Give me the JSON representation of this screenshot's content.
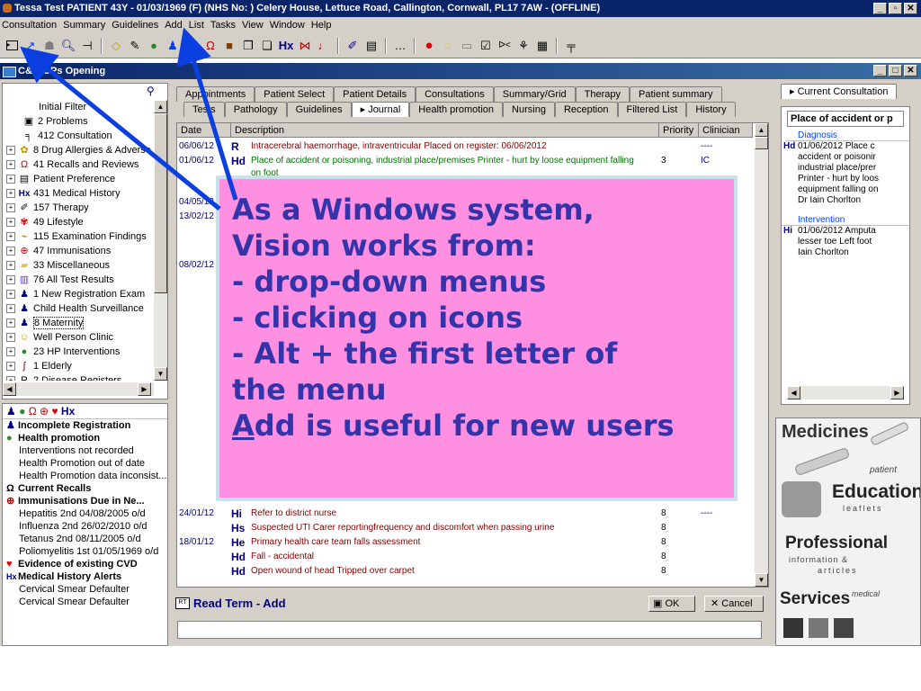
{
  "window": {
    "title": "Tessa Test PATIENT 43Y - 01/03/1969 (F) (NHS No: ) Celery House, Lettuce Road, Callington, Cornwall, PL17 7AW - (OFFLINE)",
    "child_title": "C&G GPs  Opening"
  },
  "menu": [
    "Consultation",
    "Summary",
    "Guidelines",
    "Add",
    "List",
    "Tasks",
    "View",
    "Window",
    "Help"
  ],
  "toolbar_icons": [
    "consultation-icon",
    "arrow-icon",
    "people-icon",
    "search-icon",
    "hammer-icon",
    "diamond-icon",
    "pen-icon",
    "apple-icon",
    "person-icon",
    "fork-icon",
    "recall-icon",
    "stop-icon",
    "copy-icon",
    "pages-icon",
    "rx-icon",
    "link-icon",
    "hook-icon",
    "pencil-icon",
    "note-icon",
    "ellipsis-icon",
    "red-dot-icon",
    "bubble-icon",
    "tape-icon",
    "edit-icon",
    "ab-icon",
    "pen-mark-icon",
    "calendar-icon",
    "flag-icon"
  ],
  "tree": {
    "items": [
      {
        "label": "Initial Filter",
        "icon": "",
        "exp": ""
      },
      {
        "label": "2 Problems",
        "icon": "problems-icon",
        "exp": ""
      },
      {
        "label": "412 Consultation",
        "icon": "consultation-icon",
        "exp": ""
      },
      {
        "label": "8 Drug Allergies & Adverse",
        "icon": "allergy-icon",
        "exp": "+"
      },
      {
        "label": "41 Recalls and Reviews",
        "icon": "recall-icon",
        "exp": "+"
      },
      {
        "label": "Patient Preference",
        "icon": "preference-icon",
        "exp": "+"
      },
      {
        "label": "431 Medical History",
        "icon": "rx-icon",
        "exp": "+"
      },
      {
        "label": "157 Therapy",
        "icon": "therapy-icon",
        "exp": "+"
      },
      {
        "label": "49 Lifestyle",
        "icon": "lifestyle-icon",
        "exp": "+"
      },
      {
        "label": "115 Examination Findings",
        "icon": "examination-icon",
        "exp": "+"
      },
      {
        "label": "47 Immunisations",
        "icon": "immunisation-icon",
        "exp": "+"
      },
      {
        "label": "33 Miscellaneous",
        "icon": "folder-icon",
        "exp": "+"
      },
      {
        "label": "76 All Test Results",
        "icon": "test-icon",
        "exp": "+"
      },
      {
        "label": "1 New Registration Exam",
        "icon": "person-icon",
        "exp": "+"
      },
      {
        "label": "Child Health Surveillance",
        "icon": "child-icon",
        "exp": "+"
      },
      {
        "label": "8 Maternity",
        "icon": "maternity-icon",
        "exp": "+"
      },
      {
        "label": "Well Person Clinic",
        "icon": "smiley-icon",
        "exp": "+"
      },
      {
        "label": "23 HP Interventions",
        "icon": "apple-icon",
        "exp": "+"
      },
      {
        "label": "1 Elderly",
        "icon": "elderly-icon",
        "exp": "+"
      },
      {
        "label": "2 Disease Registers",
        "icon": "register-icon",
        "exp": "+"
      }
    ]
  },
  "alerts": [
    {
      "text": "Incomplete Registration",
      "style": "b",
      "icon": "person-icon"
    },
    {
      "text": "Health promotion",
      "style": "b",
      "icon": "apple-icon"
    },
    {
      "text": "Interventions not recorded",
      "style": "ind",
      "icon": ""
    },
    {
      "text": "Health Promotion out of date",
      "style": "ind",
      "icon": ""
    },
    {
      "text": "Health Promotion data inconsist...",
      "style": "ind",
      "icon": ""
    },
    {
      "text": "Current Recalls",
      "style": "b",
      "icon": "recall-icon"
    },
    {
      "text": "Immunisations Due in Ne...",
      "style": "b",
      "icon": "immunisation-icon"
    },
    {
      "text": "Hepatitis 2nd 04/08/2005  o/d",
      "style": "ind",
      "icon": ""
    },
    {
      "text": "Influenza 2nd 26/02/2010  o/d",
      "style": "ind",
      "icon": ""
    },
    {
      "text": "Tetanus 2nd 08/11/2005  o/d",
      "style": "ind",
      "icon": ""
    },
    {
      "text": "Poliomyelitis 1st 01/05/1969  o/d",
      "style": "ind",
      "icon": ""
    },
    {
      "text": "Evidence of existing CVD",
      "style": "b",
      "icon": "heart-icon"
    },
    {
      "text": "Medical History Alerts",
      "style": "b",
      "icon": "rx-icon"
    },
    {
      "text": "Cervical Smear Defaulter",
      "style": "ind",
      "icon": ""
    },
    {
      "text": "Cervical Smear Defaulter",
      "style": "ind",
      "icon": ""
    }
  ],
  "tabs_row1": [
    "Appointments",
    "Patient Select",
    "Patient Details",
    "Consultations",
    "Summary/Grid",
    "Therapy",
    "Patient summary"
  ],
  "tabs_row2": [
    "Tests",
    "Pathology",
    "Guidelines",
    "Journal",
    "Health promotion",
    "Nursing",
    "Reception",
    "Filtered List",
    "History"
  ],
  "grid": {
    "headers": {
      "date": "Date",
      "description": "Description",
      "priority": "Priority",
      "clinician": "Clinician"
    },
    "rows": [
      {
        "date": "06/06/12",
        "icon": "R",
        "text": "Intracerebral haemorrhage, intraventricular  Placed on register: 06/06/2012",
        "priority": "",
        "clinician": "----",
        "color": "#800000"
      },
      {
        "date": "01/06/12",
        "icon": "Hd",
        "text": "Place of accident or poisoning, industrial place/premises Printer - hurt by loose equipment falling",
        "priority": "3",
        "clinician": "IC",
        "color": "#007000"
      },
      {
        "date": "",
        "icon": "",
        "text": "on foot",
        "priority": "",
        "clinician": "",
        "color": "#007000"
      },
      {
        "date": "04/05/12",
        "icon": "",
        "text": "",
        "priority": "",
        "clinician": "",
        "color": "#000"
      },
      {
        "date": "13/02/12",
        "icon": "",
        "text": "",
        "priority": "",
        "clinician": "",
        "color": "#000"
      },
      {
        "date": "08/02/12",
        "icon": "",
        "text": "",
        "priority": "",
        "clinician": "",
        "color": "#000"
      },
      {
        "date": "24/01/12",
        "icon": "Hi",
        "text": "Refer to district nurse",
        "priority": "8",
        "clinician": "----",
        "color": "#800000"
      },
      {
        "date": "",
        "icon": "Hs",
        "text": "Suspected UTI Carer reportingfrequency and discomfort when passing urine",
        "priority": "8",
        "clinician": "",
        "color": "#800000"
      },
      {
        "date": "18/01/12",
        "icon": "He",
        "text": "Primary health care team falls assessment",
        "priority": "8",
        "clinician": "",
        "color": "#800000"
      },
      {
        "date": "",
        "icon": "Hd",
        "text": "Fall - accidental",
        "priority": "8",
        "clinician": "",
        "color": "#800000"
      },
      {
        "date": "",
        "icon": "Hd",
        "text": "Open wound of head Tripped over carpet",
        "priority": "8",
        "clinician": "",
        "color": "#800000"
      }
    ]
  },
  "readterm": {
    "title": "Read Term - Add",
    "ok": "OK",
    "cancel": "Cancel",
    "input": ""
  },
  "right": {
    "tab": "Current Consultation",
    "header": "Place of accident or p",
    "diagnosis_label": "Diagnosis",
    "diagnosis_lines": [
      "01/06/2012 Place c",
      "accident or poisonir",
      "industrial place/prer",
      "Printer - hurt by loos",
      "equipment falling on",
      "Dr Iain Chorlton"
    ],
    "intervention_label": "Intervention",
    "intervention_lines": [
      "01/06/2012 Amputa",
      "lesser toe Left foot",
      "Iain Chorlton"
    ]
  },
  "leaflets": {
    "medicines": "Medicines",
    "patient": "patient",
    "education": "Education",
    "leaflets": "leaflets",
    "professional": "Professional",
    "information": "information &",
    "articles": "articles",
    "services": "Services",
    "medical": "medical"
  },
  "callout": {
    "lines": [
      "As a Windows system,",
      "Vision works from:",
      "- drop-down menus",
      "- clicking on icons",
      "- Alt + the first letter of",
      "the menu"
    ],
    "last_first": "A",
    "last_rest": "dd is useful for new users"
  },
  "colors": {
    "arrow": "#0b3fe0",
    "callout_bg": "#ff8fe0",
    "callout_text": "#3333aa"
  }
}
